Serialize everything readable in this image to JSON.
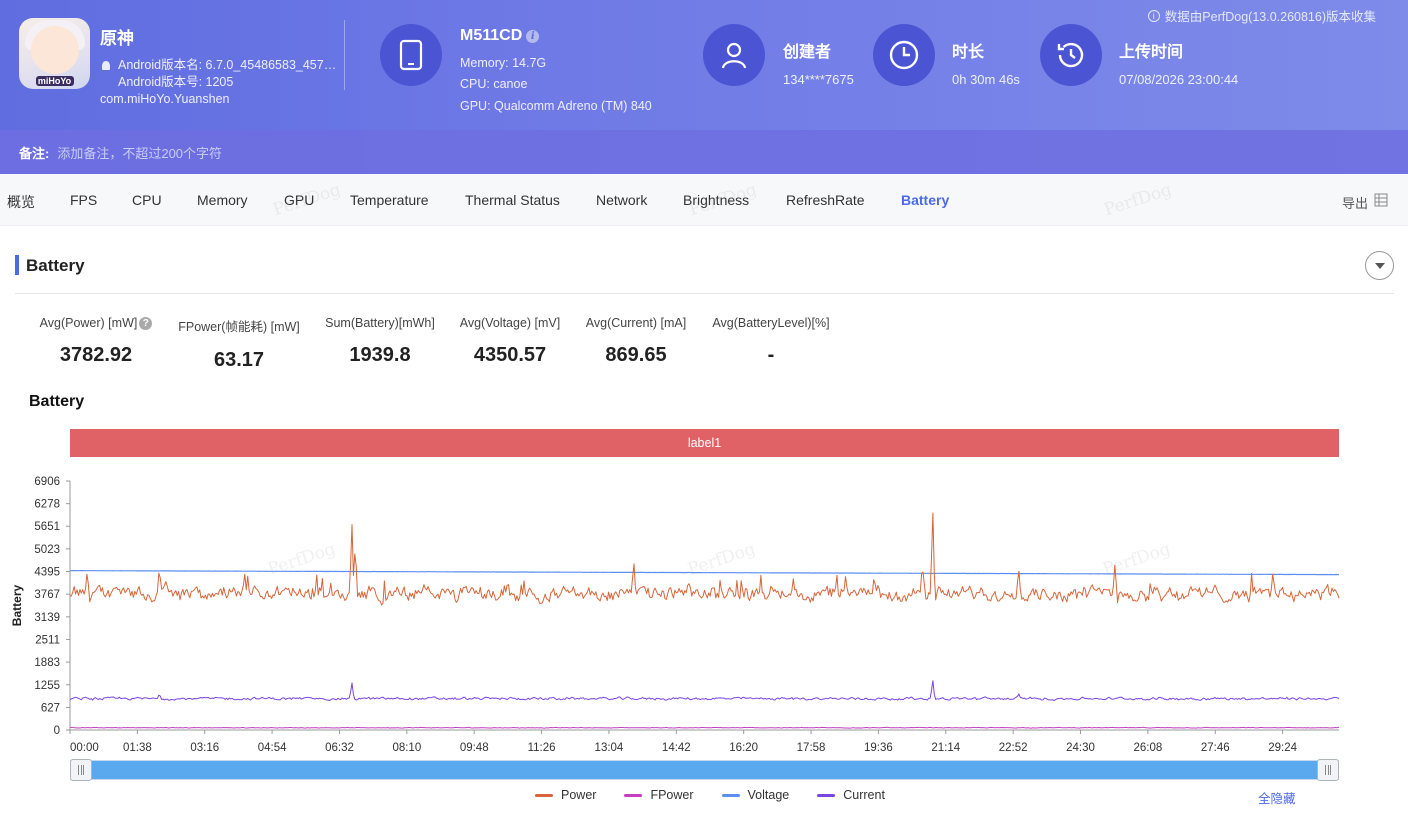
{
  "header": {
    "data_source": "数据由PerfDog(13.0.260816)版本收集",
    "app": {
      "name": "原神",
      "icon_text": "miHoYo",
      "version_name": "Android版本名: 6.7.0_45486583_457…",
      "version_code": "Android版本号: 1205",
      "package": "com.miHoYo.Yuanshen"
    },
    "device": {
      "name": "M511CD",
      "memory": "Memory: 14.7G",
      "cpu": "CPU: canoe",
      "gpu": "GPU: Qualcomm Adreno (TM) 840"
    },
    "creator": {
      "title": "创建者",
      "value": "134****7675"
    },
    "duration": {
      "title": "时长",
      "value": "0h 30m 46s"
    },
    "upload": {
      "title": "上传时间",
      "value": "07/08/2026 23:00:44"
    },
    "note": {
      "label": "备注:",
      "placeholder": "添加备注，不超过200个字符"
    }
  },
  "tabs": [
    "概览",
    "FPS",
    "CPU",
    "Memory",
    "GPU",
    "Temperature",
    "Thermal Status",
    "Network",
    "Brightness",
    "RefreshRate",
    "Battery"
  ],
  "active_tab": "Battery",
  "export_label": "导出",
  "watermark": "PerfDog",
  "section": {
    "title": "Battery",
    "stats": [
      {
        "label": "Avg(Power) [mW]",
        "value": "3782.92"
      },
      {
        "label": "FPower(帧能耗) [mW]",
        "value": "63.17"
      },
      {
        "label": "Sum(Battery)[mWh]",
        "value": "1939.8"
      },
      {
        "label": "Avg(Voltage) [mV]",
        "value": "4350.57"
      },
      {
        "label": "Avg(Current) [mA]",
        "value": "869.65"
      },
      {
        "label": "Avg(BatteryLevel)[%]",
        "value": "-"
      }
    ]
  },
  "chart_data": {
    "type": "line",
    "title": "Battery",
    "ylabel": "Battery",
    "band_label": "label1",
    "ylim": [
      0,
      6906
    ],
    "yticks": [
      "0",
      "627",
      "1255",
      "1883",
      "2511",
      "3139",
      "3767",
      "4395",
      "5023",
      "5651",
      "6278",
      "6906"
    ],
    "xticks": [
      "00:00",
      "01:38",
      "03:16",
      "04:54",
      "06:32",
      "08:10",
      "09:48",
      "11:26",
      "13:04",
      "14:42",
      "16:20",
      "17:58",
      "19:36",
      "21:14",
      "22:52",
      "24:30",
      "26:08",
      "27:46",
      "29:24"
    ],
    "x_range_seconds": [
      0,
      1846
    ],
    "series": [
      {
        "name": "Power",
        "color": "#d6663a",
        "mean": 3783,
        "noise": 190,
        "spikes": [
          [
            25,
            4400
          ],
          [
            130,
            4550
          ],
          [
            410,
            5850
          ],
          [
            415,
            5200
          ],
          [
            820,
            4750
          ],
          [
            1240,
            4650
          ],
          [
            1255,
            6250
          ],
          [
            1380,
            4500
          ],
          [
            1520,
            4600
          ],
          [
            1750,
            4400
          ]
        ]
      },
      {
        "name": "FPower",
        "color": "#c43fc1",
        "mean": 63,
        "noise": 8,
        "spikes": []
      },
      {
        "name": "Voltage",
        "color": "#5b8ff0",
        "start": 4420,
        "end": 4310,
        "noise": 3,
        "spikes": []
      },
      {
        "name": "Current",
        "color": "#7b45e0",
        "mean": 870,
        "noise": 35,
        "spikes": [
          [
            410,
            1340
          ],
          [
            1255,
            1420
          ],
          [
            130,
            1000
          ],
          [
            1380,
            1020
          ]
        ]
      }
    ],
    "legend_position": "bottom",
    "grid": false
  },
  "hide_all_label": "全隐藏"
}
